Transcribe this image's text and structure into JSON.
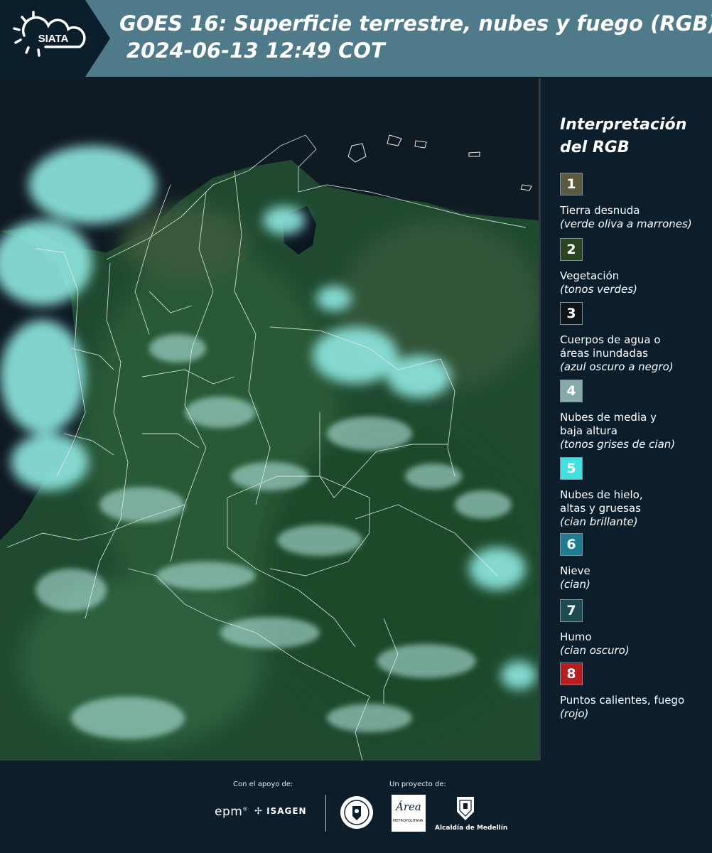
{
  "header": {
    "brand": "SIATA",
    "title_line1": "GOES 16: Superficie terrestre, nubes y fuego (RGB)",
    "title_line2": "2024-06-13 12:49 COT"
  },
  "legend": {
    "title_line1": "Interpretación",
    "title_line2": "del RGB",
    "items": [
      {
        "number": "1",
        "color": "#5c5a3e",
        "label_lines": [
          "Tierra desnuda"
        ],
        "desc": "(verde oliva a marrones)"
      },
      {
        "number": "2",
        "color": "#2c4521",
        "label_lines": [
          "Vegetación"
        ],
        "desc": "(tonos verdes)"
      },
      {
        "number": "3",
        "color": "#0e1418",
        "label_lines": [
          "Cuerpos de agua o",
          "áreas inundadas"
        ],
        "desc": "(azul oscuro a negro)"
      },
      {
        "number": "4",
        "color": "#86aaa8",
        "label_lines": [
          "Nubes de media y",
          "baja altura"
        ],
        "desc": "(tonos grises de cian)"
      },
      {
        "number": "5",
        "color": "#3fe2de",
        "label_lines": [
          "Nubes de hielo,",
          "altas y gruesas"
        ],
        "desc": "(cian brillante)"
      },
      {
        "number": "6",
        "color": "#1f7b90",
        "label_lines": [
          "Nieve"
        ],
        "desc": "(cian)"
      },
      {
        "number": "7",
        "color": "#1c4c52",
        "label_lines": [
          "Humo"
        ],
        "desc": "(cian oscuro)"
      },
      {
        "number": "8",
        "color": "#b81d22",
        "label_lines": [
          "Puntos calientes, fuego"
        ],
        "desc": "(rojo)"
      }
    ]
  },
  "footer": {
    "support_label": "Con el apoyo de:",
    "project_label": "Un proyecto de:",
    "sponsor_epm": "epm",
    "sponsor_isagen": "ISAGEN",
    "area_logo_text": "Área",
    "area_logo_sub": "METROPOLITANA",
    "alcaldia": "Alcaldía de Medellín"
  }
}
